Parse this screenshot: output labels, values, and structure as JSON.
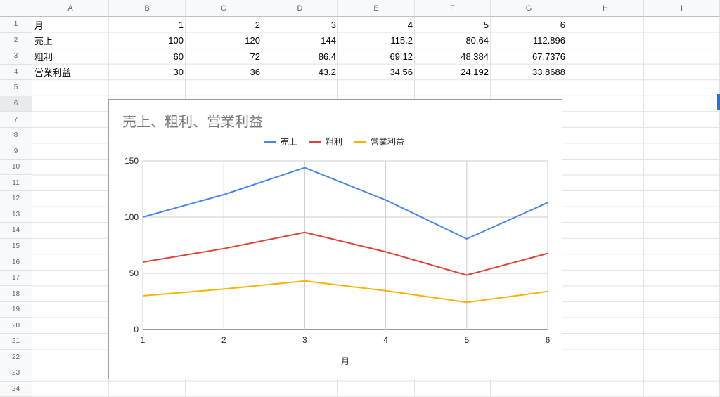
{
  "columns": [
    "A",
    "B",
    "C",
    "D",
    "E",
    "F",
    "G",
    "H",
    "I"
  ],
  "rows": [
    "1",
    "2",
    "3",
    "4",
    "5",
    "6",
    "7",
    "8",
    "9",
    "10",
    "11",
    "12",
    "13",
    "14",
    "15",
    "16",
    "17",
    "18",
    "19",
    "20",
    "21",
    "22",
    "23",
    "24"
  ],
  "active_row": "6",
  "table": [
    {
      "label": "月",
      "values": [
        "1",
        "2",
        "3",
        "4",
        "5",
        "6"
      ]
    },
    {
      "label": "売上",
      "values": [
        "100",
        "120",
        "144",
        "115.2",
        "80.64",
        "112.896"
      ]
    },
    {
      "label": "粗利",
      "values": [
        "60",
        "72",
        "86.4",
        "69.12",
        "48.384",
        "67.7376"
      ]
    },
    {
      "label": "営業利益",
      "values": [
        "30",
        "36",
        "43.2",
        "34.56",
        "24.192",
        "33.8688"
      ]
    }
  ],
  "chart_data": {
    "type": "line",
    "title": "売上、粗利、営業利益",
    "xlabel": "月",
    "ylabel": "",
    "x": [
      1,
      2,
      3,
      4,
      5,
      6
    ],
    "series": [
      {
        "name": "売上",
        "color": "#4a86e8",
        "values": [
          100,
          120,
          144,
          115.2,
          80.64,
          112.896
        ]
      },
      {
        "name": "粗利",
        "color": "#db4437",
        "values": [
          60,
          72,
          86.4,
          69.12,
          48.384,
          67.7376
        ]
      },
      {
        "name": "営業利益",
        "color": "#f4b400",
        "values": [
          30,
          36,
          43.2,
          34.56,
          24.192,
          33.8688
        ]
      }
    ],
    "ylim": [
      0,
      150
    ],
    "yticks": [
      0,
      50,
      100,
      150
    ],
    "xticks": [
      "1",
      "2",
      "3",
      "4",
      "5",
      "6"
    ],
    "grid": true,
    "legend": "top"
  }
}
